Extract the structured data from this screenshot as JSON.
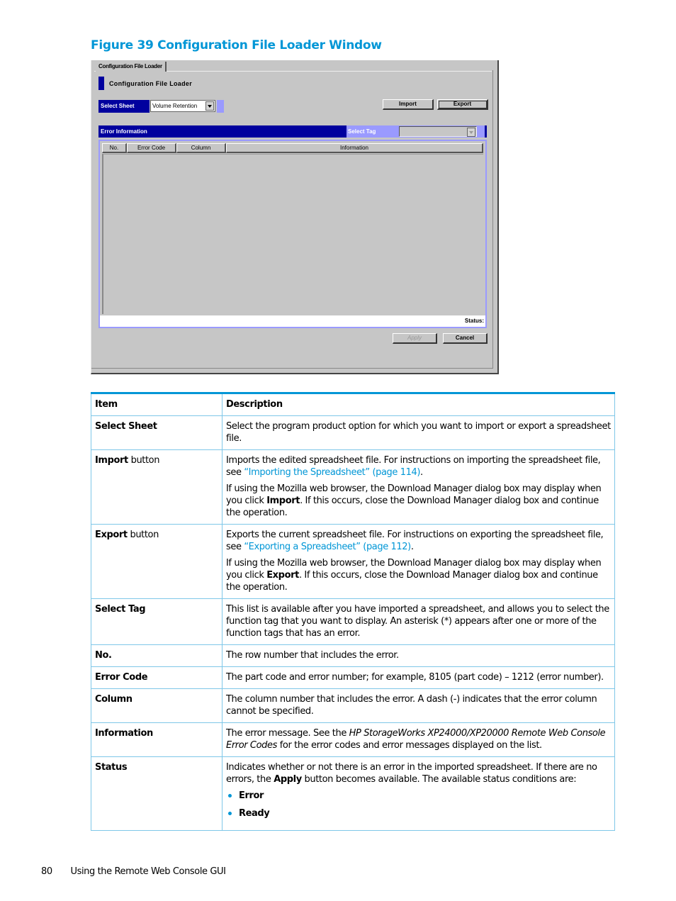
{
  "figure": {
    "title": "Figure 39 Configuration File Loader Window"
  },
  "window": {
    "tab_label": "Configuration File Loader",
    "panel_title": "Configuration File Loader",
    "select_sheet": {
      "label": "Select Sheet",
      "value": "Volume Retention"
    },
    "buttons": {
      "import": "Import",
      "export": "Export",
      "apply": "Apply",
      "cancel": "Cancel"
    },
    "error_section": {
      "label": "Error Information",
      "select_tag_label": "Select Tag",
      "select_tag_value": ""
    },
    "columns": [
      "No.",
      "Error Code",
      "Column",
      "Information"
    ],
    "status_label": "Status:"
  },
  "table": {
    "headers": {
      "item": "Item",
      "description": "Description"
    },
    "rows": [
      {
        "item": "Select Sheet",
        "desc": "Select the program product option for which you want to import or export a spreadsheet file."
      },
      {
        "item_bold": "Import",
        "item_rest": " button",
        "p1_before": "Imports the edited spreadsheet file. For instructions on importing the spreadsheet file, see ",
        "p1_link": "“Importing the Spreadsheet” (page 114)",
        "p1_after": ".",
        "p2_before": "If using the Mozilla web browser, the Download Manager dialog box may display when you click ",
        "p2_bold": "Import",
        "p2_after": ". If this occurs, close the Download Manager dialog box and continue the operation."
      },
      {
        "item_bold": "Export",
        "item_rest": " button",
        "p1_before": "Exports the current spreadsheet file. For instructions on exporting the spreadsheet file, see ",
        "p1_link": "“Exporting a Spreadsheet” (page 112)",
        "p1_after": ".",
        "p2_before": "If using the Mozilla web browser, the Download Manager dialog box may display when you click ",
        "p2_bold": "Export",
        "p2_after": ". If this occurs, close the Download Manager dialog box and continue the operation."
      },
      {
        "item": "Select Tag",
        "desc": "This list is available after you have imported a spreadsheet, and allows you to select the function tag that you want to display. An asterisk (*) appears after one or more of the function tags that has an error."
      },
      {
        "item": "No.",
        "desc": "The row number that includes the error."
      },
      {
        "item": "Error Code",
        "desc": "The part code and error number; for example, 8105 (part code) – 1212 (error number)."
      },
      {
        "item": "Column",
        "desc": "The column number that includes the error. A dash (-) indicates that the error column cannot be specified."
      },
      {
        "item": "Information",
        "desc_before": "The error message. See the ",
        "desc_italic": "HP StorageWorks XP24000/XP20000 Remote Web Console Error Codes",
        "desc_after": " for the error codes and error messages displayed on the list."
      },
      {
        "item": "Status",
        "desc_before": "Indicates whether or not there is an error in the imported spreadsheet. If there are no errors, the ",
        "desc_bold": "Apply",
        "desc_after": " button becomes available. The available status conditions are:",
        "bullets": [
          "Error",
          "Ready"
        ]
      }
    ]
  },
  "footer": {
    "page_number": "80",
    "section": "Using the Remote Web Console GUI"
  },
  "colors": {
    "accent": "#0096d6",
    "navy": "#00009e",
    "lavender": "#9a9aff",
    "window_gray": "#c6c6c6"
  }
}
